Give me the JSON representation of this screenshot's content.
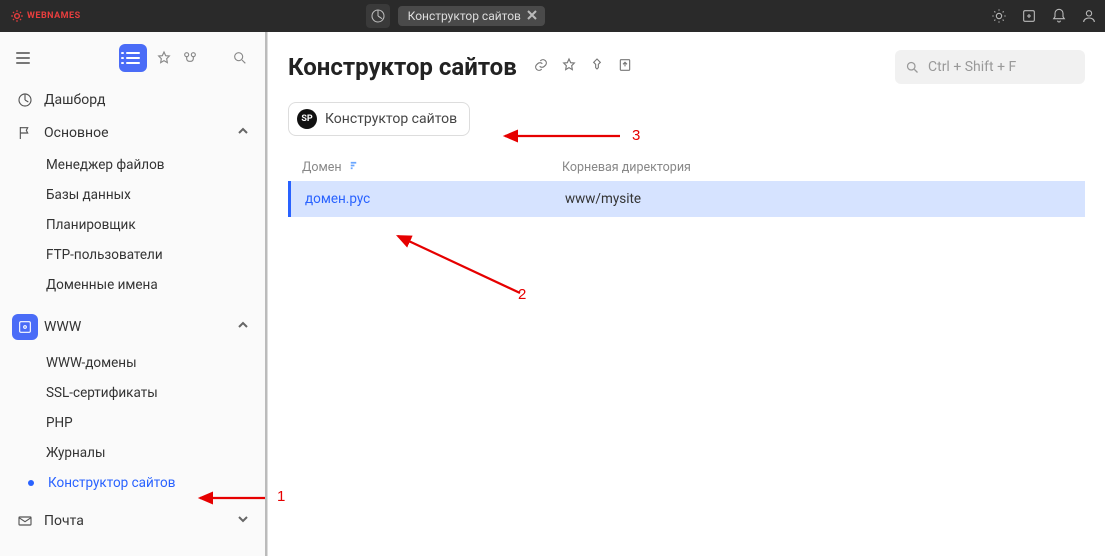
{
  "brand": {
    "name": "WEBNAMES"
  },
  "tab": {
    "label": "Конструктор сайтов"
  },
  "sidebar": {
    "dashboard": "Дашборд",
    "main": {
      "label": "Основное",
      "items": [
        "Менеджер файлов",
        "Базы данных",
        "Планировщик",
        "FTP-пользователи",
        "Доменные имена"
      ]
    },
    "www": {
      "label": "WWW",
      "items": [
        "WWW-домены",
        "SSL-сертификаты",
        "PHP",
        "Журналы",
        "Конструктор сайтов"
      ]
    },
    "mail": "Почта"
  },
  "page": {
    "title": "Конструктор сайтов",
    "search_placeholder": "Ctrl + Shift + F"
  },
  "chip": {
    "badge": "SP",
    "label": "Конструктор сайтов"
  },
  "table": {
    "columns": {
      "domain": "Домен",
      "root": "Корневая директория"
    },
    "rows": [
      {
        "domain": "домен.рус",
        "root": "www/mysite"
      }
    ]
  },
  "annotations": {
    "n1": "1",
    "n2": "2",
    "n3": "3"
  }
}
